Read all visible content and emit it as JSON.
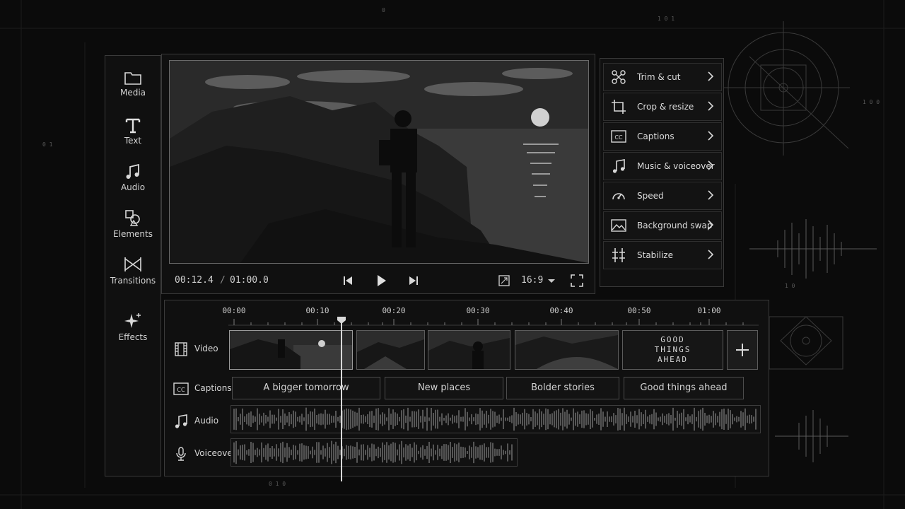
{
  "sidebar": {
    "items": [
      {
        "label": "Media",
        "icon": "folder-icon"
      },
      {
        "label": "Text",
        "icon": "text-icon"
      },
      {
        "label": "Audio",
        "icon": "music-note-icon"
      },
      {
        "label": "Elements",
        "icon": "shapes-icon"
      },
      {
        "label": "Transitions",
        "icon": "transition-icon"
      },
      {
        "label": "Effects",
        "icon": "sparkle-icon"
      }
    ]
  },
  "preview": {
    "current_time": "00:12.4",
    "separator": "/",
    "duration": "01:00.0",
    "aspect_ratio": "16:9"
  },
  "tools": {
    "items": [
      {
        "label": "Trim & cut",
        "icon": "scissors-icon"
      },
      {
        "label": "Crop & resize",
        "icon": "crop-icon"
      },
      {
        "label": "Captions",
        "icon": "closed-captions-icon"
      },
      {
        "label": "Music & voiceover",
        "icon": "music-note-icon"
      },
      {
        "label": "Speed",
        "icon": "speedometer-icon"
      },
      {
        "label": "Background swap",
        "icon": "image-icon"
      },
      {
        "label": "Stabilize",
        "icon": "stabilize-icon"
      }
    ]
  },
  "timeline": {
    "ticks": [
      "00:00",
      "00:10",
      "00:20",
      "00:30",
      "00:40",
      "00:50",
      "01:00"
    ],
    "playhead_time": "00:12.4",
    "tracks": {
      "video": "Video",
      "captions": "Captions",
      "audio": "Audio",
      "voiceover": "Voiceover"
    },
    "title_card": [
      "GOOD",
      "THINGS",
      "AHEAD"
    ],
    "captions": [
      "A bigger tomorrow",
      "New places",
      "Bolder stories",
      "Good things ahead"
    ]
  },
  "decor": {
    "binary_strings": [
      "0",
      "1 0 1",
      "1 0 0",
      "0 1",
      "1 0",
      "0 1 0"
    ]
  },
  "colors": {
    "background": "#0b0b0b",
    "panel": "#101010",
    "border": "#3a3a3a",
    "foreground": "#d8d8d8"
  }
}
